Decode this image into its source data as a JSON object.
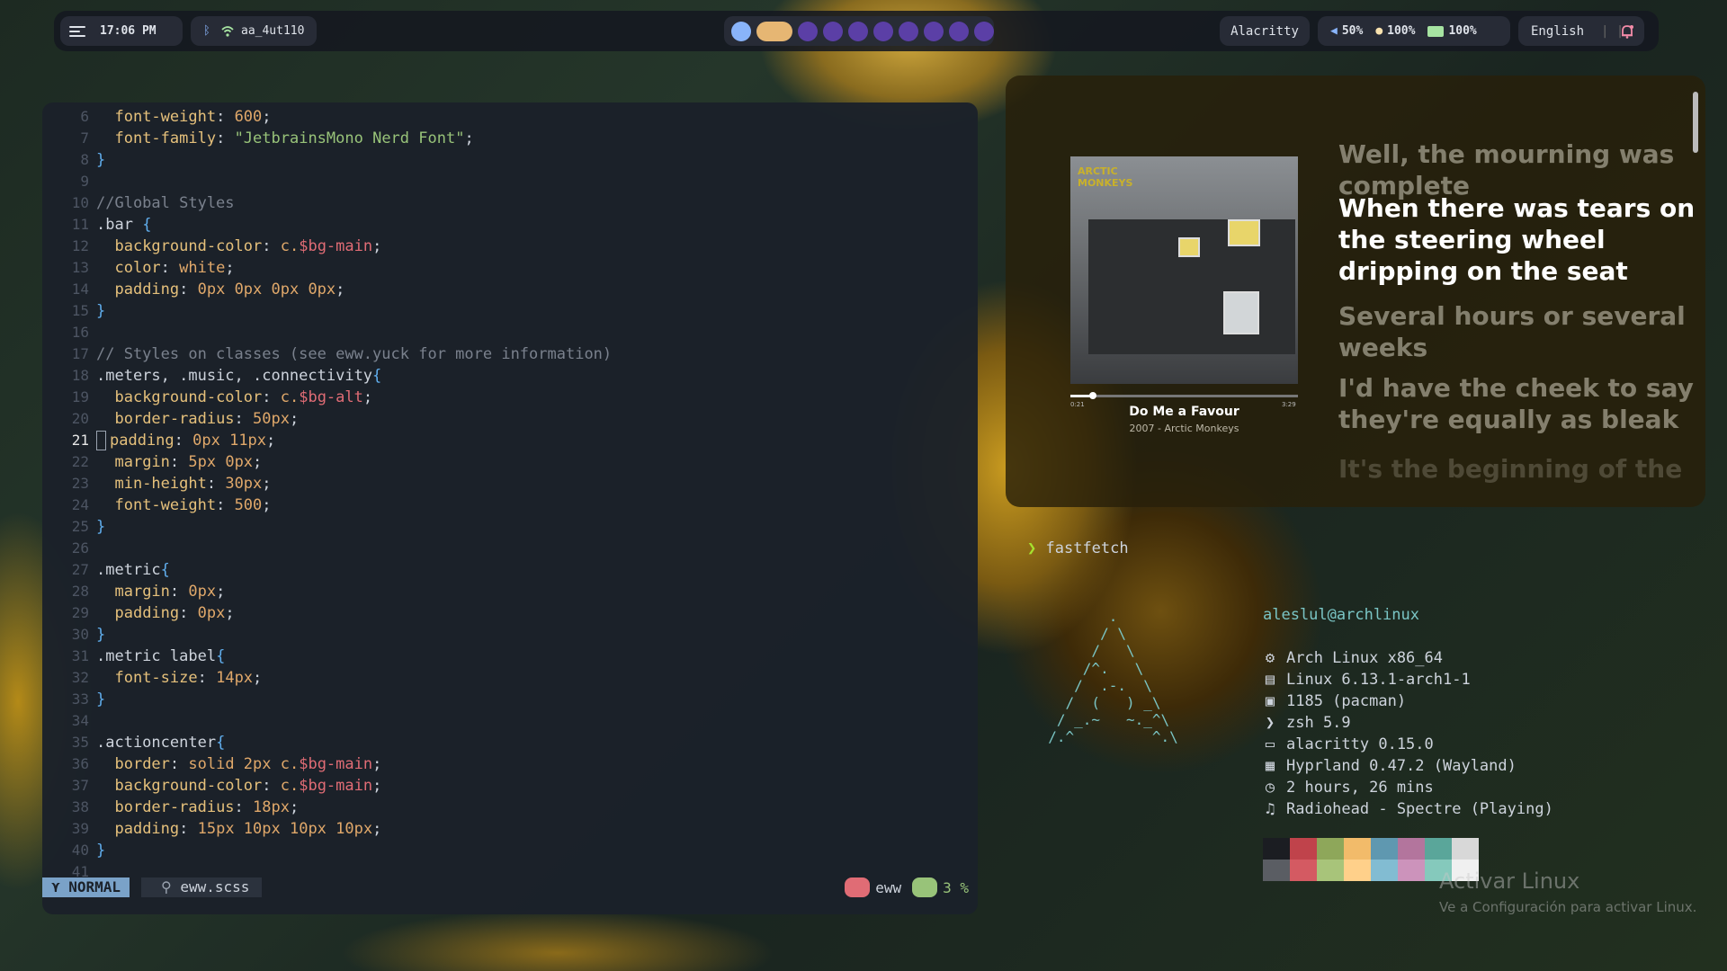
{
  "topbar": {
    "time": "17:06 PM",
    "wifi_name": "aa_4ut110",
    "active_window": "Alacritty",
    "volume": "50%",
    "brightness": "100%",
    "battery": "100%",
    "language": "English",
    "workspaces": [
      {
        "state": "active",
        "color": "#89b4fa"
      },
      {
        "state": "focused",
        "color": "#e6b673"
      },
      {
        "state": "empty",
        "color": "#5b3fa6"
      },
      {
        "state": "empty",
        "color": "#5b3fa6"
      },
      {
        "state": "empty",
        "color": "#5b3fa6"
      },
      {
        "state": "empty",
        "color": "#5b3fa6"
      },
      {
        "state": "empty",
        "color": "#5b3fa6"
      },
      {
        "state": "empty",
        "color": "#5b3fa6"
      },
      {
        "state": "empty",
        "color": "#5b3fa6"
      },
      {
        "state": "empty",
        "color": "#5b3fa6"
      }
    ],
    "icons": [
      "menu-icon",
      "bluetooth-icon",
      "wifi-icon",
      "volume-icon",
      "brightness-icon",
      "battery-icon",
      "notification-bell-icon"
    ]
  },
  "editor": {
    "current_line": 21,
    "lines": [
      {
        "n": "6",
        "t": "  font-weight: 600;"
      },
      {
        "n": "7",
        "t": "  font-family: \"JetbrainsMono Nerd Font\";"
      },
      {
        "n": "8",
        "t": "}"
      },
      {
        "n": "9",
        "t": ""
      },
      {
        "n": "10",
        "t": "//Global Styles"
      },
      {
        "n": "11",
        "t": ".bar {"
      },
      {
        "n": "12",
        "t": "  background-color: c.$bg-main;"
      },
      {
        "n": "13",
        "t": "  color: white;"
      },
      {
        "n": "14",
        "t": "  padding: 0px 0px 0px 0px;"
      },
      {
        "n": "15",
        "t": "}"
      },
      {
        "n": "16",
        "t": ""
      },
      {
        "n": "17",
        "t": "// Styles on classes (see eww.yuck for more information)"
      },
      {
        "n": "18",
        "t": ".meters, .music, .connectivity{"
      },
      {
        "n": "19",
        "t": "  background-color: c.$bg-alt;"
      },
      {
        "n": "20",
        "t": "  border-radius: 50px;"
      },
      {
        "n": "21",
        "t": "  padding: 0px 11px;"
      },
      {
        "n": "22",
        "t": "  margin: 5px 0px;"
      },
      {
        "n": "23",
        "t": "  min-height: 30px;"
      },
      {
        "n": "24",
        "t": "  font-weight: 500;"
      },
      {
        "n": "25",
        "t": "}"
      },
      {
        "n": "26",
        "t": ""
      },
      {
        "n": "27",
        "t": ".metric{"
      },
      {
        "n": "28",
        "t": "  margin: 0px;"
      },
      {
        "n": "29",
        "t": "  padding: 0px;"
      },
      {
        "n": "30",
        "t": "}"
      },
      {
        "n": "31",
        "t": ".metric label{"
      },
      {
        "n": "32",
        "t": "  font-size: 14px;"
      },
      {
        "n": "33",
        "t": "}"
      },
      {
        "n": "34",
        "t": ""
      },
      {
        "n": "35",
        "t": ".actioncenter{"
      },
      {
        "n": "36",
        "t": "  border: solid 2px c.$bg-main;"
      },
      {
        "n": "37",
        "t": "  background-color: c.$bg-main;"
      },
      {
        "n": "38",
        "t": "  border-radius: 18px;"
      },
      {
        "n": "39",
        "t": "  padding: 15px 10px 10px 10px;"
      },
      {
        "n": "40",
        "t": "}"
      },
      {
        "n": "41",
        "t": ""
      }
    ],
    "statusline": {
      "mode": "NORMAL",
      "filename": "eww.scss",
      "branch": "eww",
      "percent": "3 %"
    }
  },
  "music": {
    "song": "Do Me a Favour",
    "subtitle": "2007 - Arctic Monkeys",
    "time_elapsed": "0:21",
    "time_total": "3:29",
    "progress": 0.1,
    "lyrics": [
      {
        "text": "Well, the mourning was complete",
        "state": "past"
      },
      {
        "text": "When there was tears on the steering wheel dripping on the seat",
        "state": "current"
      },
      {
        "text": "Several hours or several weeks",
        "state": "next"
      },
      {
        "text": "I'd have the cheek to say they're equally as bleak",
        "state": "next"
      },
      {
        "text": "It's the beginning of the",
        "state": "fade"
      }
    ]
  },
  "terminal": {
    "prompt_symbol": "❯",
    "command": "fastfetch",
    "user_host": "aleslul@archlinux",
    "info": [
      {
        "icon": "gear-icon",
        "glyph": "⚙",
        "text": "Arch Linux x86_64"
      },
      {
        "icon": "kernel-icon",
        "glyph": "▤",
        "text": "Linux 6.13.1-arch1-1"
      },
      {
        "icon": "package-icon",
        "glyph": "▣",
        "text": "1185 (pacman)"
      },
      {
        "icon": "shell-icon",
        "glyph": "❯",
        "text": "zsh 5.9"
      },
      {
        "icon": "terminal-icon",
        "glyph": "▭",
        "text": "alacritty 0.15.0"
      },
      {
        "icon": "window-manager-icon",
        "glyph": "▦",
        "text": "Hyprland 0.47.2 (Wayland)"
      },
      {
        "icon": "clock-icon",
        "glyph": "◷",
        "text": "2 hours, 26 mins"
      },
      {
        "icon": "music-note-icon",
        "glyph": "♫",
        "text": "Radiohead - Spectre (Playing)"
      }
    ],
    "palette_top": [
      "#1b1d22",
      "#c0434b",
      "#8ea75a",
      "#f2bb6a",
      "#5f98b0",
      "#b3759d",
      "#5aa69a",
      "#d8d8d8"
    ],
    "palette_bottom": [
      "#5a5d63",
      "#d45a62",
      "#a8c47a",
      "#ffd08a",
      "#82bcd2",
      "#cc93bb",
      "#85c9bc",
      "#f0f0f0"
    ]
  },
  "watermark": {
    "title": "Activar Linux",
    "subtitle": "Ve a Configuración para activar Linux."
  }
}
